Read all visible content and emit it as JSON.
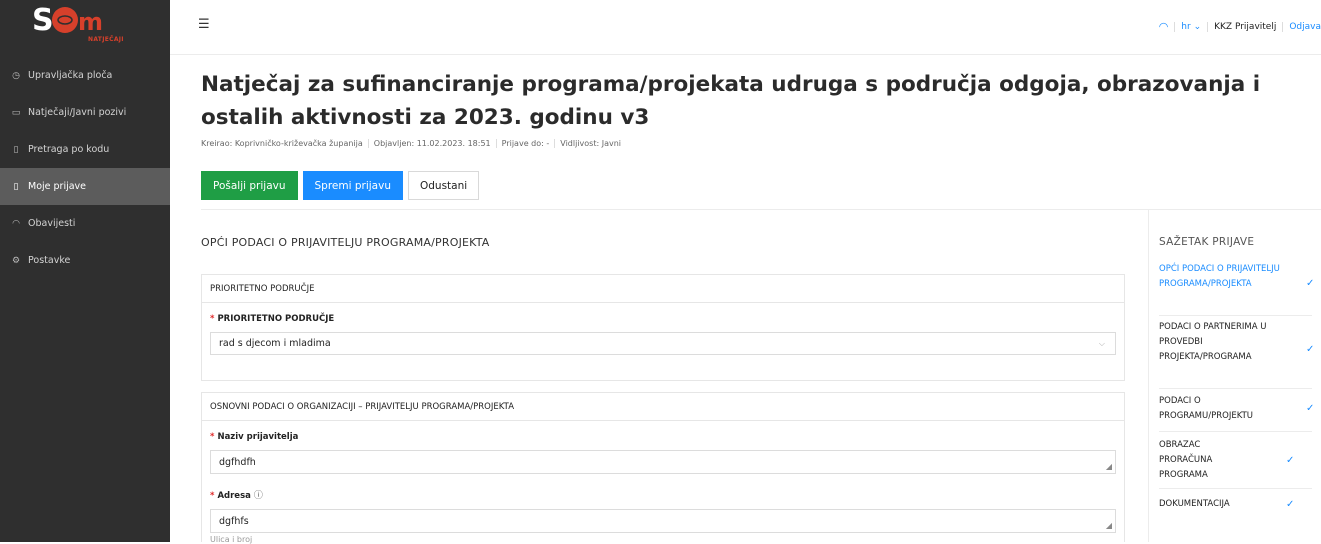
{
  "brand": {
    "name": "SOM",
    "subtitle": "NATJEČAJI",
    "accent": "#d6402b"
  },
  "sidebar": {
    "items": [
      {
        "label": "Upravljačka ploča",
        "icon": "dashboard-icon",
        "glyph": "◷"
      },
      {
        "label": "Natječaji/Javni pozivi",
        "icon": "folder-icon",
        "glyph": "▭"
      },
      {
        "label": "Pretraga po kodu",
        "icon": "document-icon",
        "glyph": "▯"
      },
      {
        "label": "Moje prijave",
        "icon": "document-icon",
        "glyph": "▯",
        "active": true
      },
      {
        "label": "Obavijesti",
        "icon": "bell-icon",
        "glyph": "◠"
      },
      {
        "label": "Postavke",
        "icon": "gear-icon",
        "glyph": "⚙"
      }
    ]
  },
  "topbar": {
    "language": "hr",
    "user": "KKZ Prijavitelj",
    "logout": "Odjava"
  },
  "page": {
    "title": "Natječaj za sufinanciranje programa/projekata udruga s područja odgoja, obrazovanja i ostalih aktivnosti za 2023. godinu v3",
    "meta": {
      "created": "Kreirao: Koprivničko-križevačka županija",
      "published": "Objavljen: 11.02.2023. 18:51",
      "deadline": "Prijave do: -",
      "visibility": "Vidljivost: Javni"
    },
    "buttons": {
      "send": "Pošalji prijavu",
      "save": "Spremi prijavu",
      "cancel": "Odustani"
    }
  },
  "form": {
    "section_title": "OPĆI PODACI O PRIJAVITELJU PROGRAMA/PROJEKTA",
    "priority": {
      "header": "PRIORITETNO PODRUČJE",
      "label": "PRIORITETNO PODRUČJE",
      "value": "rad s djecom i mladima"
    },
    "org": {
      "header": "OSNOVNI PODACI O ORGANIZACIJI – PRIJAVITELJU PROGRAMA/PROJEKTA",
      "name_label": "Naziv prijavitelja",
      "name_value": "dgfhdfh",
      "address_label": "Adresa",
      "address_value": "dgfhfs",
      "address_hint": "Ulica i broj"
    }
  },
  "summary": {
    "title": "SAŽETAK PRIJAVE",
    "items": [
      "OPĆI PODACI O PRIJAVITELJU PROGRAMA/PROJEKTA",
      "PODACI O PARTNERIMA U PROVEDBI PROJEKTA/PROGRAMA",
      "PODACI O PROGRAMU/PROJEKTU",
      "OBRAZAC PRORAČUNA PROGRAMA",
      "DOKUMENTACIJA"
    ]
  },
  "colors": {
    "primary": "#1a8cff",
    "success": "#1f9e45",
    "required": "#e02b2b",
    "sidebar": "#2f2f2f"
  }
}
